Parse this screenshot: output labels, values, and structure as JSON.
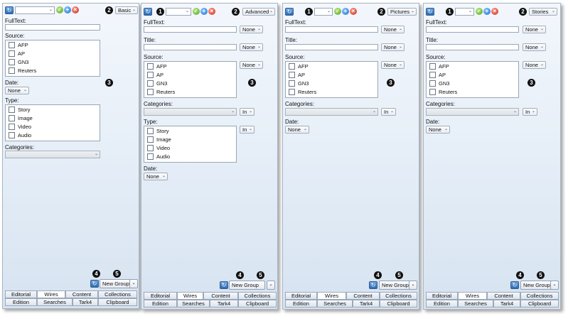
{
  "markers": [
    "1",
    "2",
    "3",
    "4",
    "5"
  ],
  "labels": {
    "fulltext": "FullText:",
    "title": "Title:",
    "source": "Source:",
    "date": "Date:",
    "type": "Type:",
    "categories": "Categories:"
  },
  "sources": [
    "AFP",
    "AP",
    "GN3",
    "Reuters"
  ],
  "types": [
    "Story",
    "Image",
    "Video",
    "Audio"
  ],
  "dropdowns": {
    "none": "None",
    "in": "In",
    "arrow": "⌄"
  },
  "panels": {
    "p1": {
      "mode": "Basic"
    },
    "p2": {
      "mode": "Advanced"
    },
    "p3": {
      "mode": "Pictures"
    },
    "p4": {
      "mode": "Stories"
    }
  },
  "buttons": {
    "new_group": "New Group"
  },
  "tabs_top": [
    "Editorial",
    "Wires",
    "Content",
    "Collections"
  ],
  "tabs_bottom": [
    "Edition",
    "Searches",
    "Tark4",
    "Clipboard"
  ],
  "colors": {
    "accent": "#2c6bb2",
    "ok": "#5a9e22",
    "add": "#1f6fd0",
    "delete": "#c62d1d"
  }
}
